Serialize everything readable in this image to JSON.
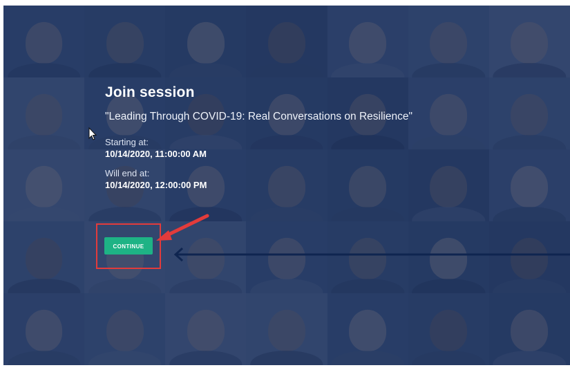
{
  "session": {
    "title": "Join session",
    "name": "\"Leading Through COVID-19: Real Conversations on Resilience\"",
    "start_label": "Starting at:",
    "start_value": "10/14/2020, 11:00:00 AM",
    "end_label": "Will end at:",
    "end_value": "10/14/2020, 12:00:00 PM",
    "continue_label": "CONTINUE"
  },
  "colors": {
    "overlay": "#1c315c",
    "button": "#1eb385",
    "highlight": "#e33b3b",
    "arrow_dark": "#0f2550"
  },
  "icons": {
    "cursor": "mouse-cursor-icon",
    "red_arrow": "red-arrow-icon",
    "blue_arrow": "blue-arrow-icon"
  }
}
